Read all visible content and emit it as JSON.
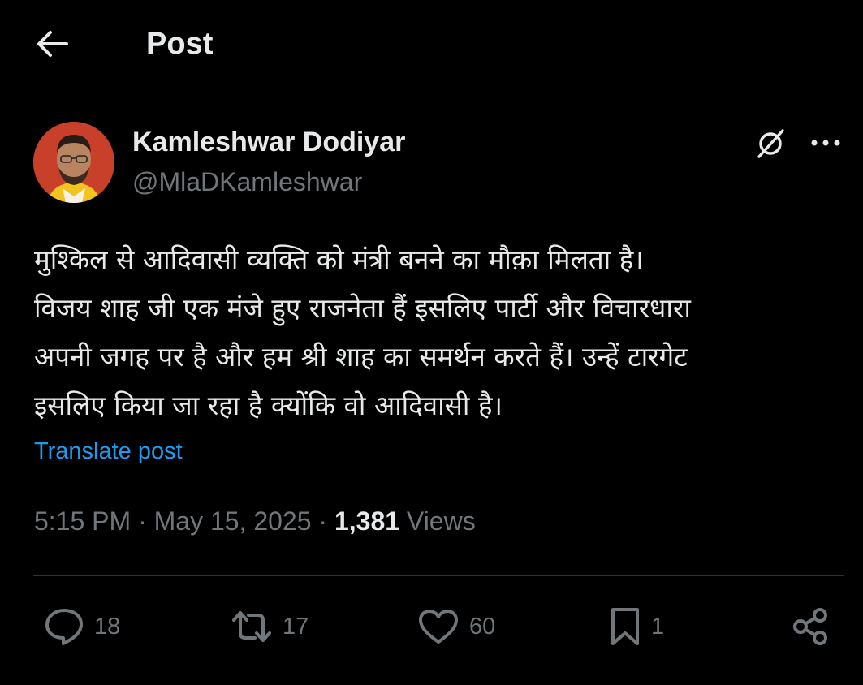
{
  "header": {
    "title": "Post"
  },
  "author": {
    "display_name": "Kamleshwar Dodiyar",
    "handle": "@MlaDKamleshwar"
  },
  "post": {
    "lines": [
      "मुश्किल से आदिवासी व्यक्ति को मंत्री बनने का मौक़ा मिलता है।",
      "विजय शाह जी एक मंजे हुए राजनेता हैं इसलिए पार्टी और विचारधारा",
      "अपनी जगह पर है और हम श्री शाह का समर्थन करते हैं। उन्हें टारगेट",
      "इसलिए किया जा रहा है क्योंकि वो आदिवासी है।"
    ],
    "translate_label": "Translate post"
  },
  "meta": {
    "time": "5:15 PM",
    "separator": "·",
    "date": "May 15, 2025",
    "views_count": "1,381",
    "views_label": "Views"
  },
  "actions": {
    "replies": "18",
    "reposts": "17",
    "likes": "60",
    "bookmarks": "1"
  },
  "icons": {
    "back": "arrow-left-icon",
    "grok": "grok-icon",
    "more": "more-horizontal-icon",
    "reply": "speech-bubble-icon",
    "repost": "repost-icon",
    "like": "heart-icon",
    "bookmark": "bookmark-icon",
    "share": "share-icon"
  },
  "colors": {
    "background": "#000000",
    "text": "#e7e9ea",
    "secondary": "#71767b",
    "link": "#1d9bf0",
    "divider": "#2f3336"
  }
}
